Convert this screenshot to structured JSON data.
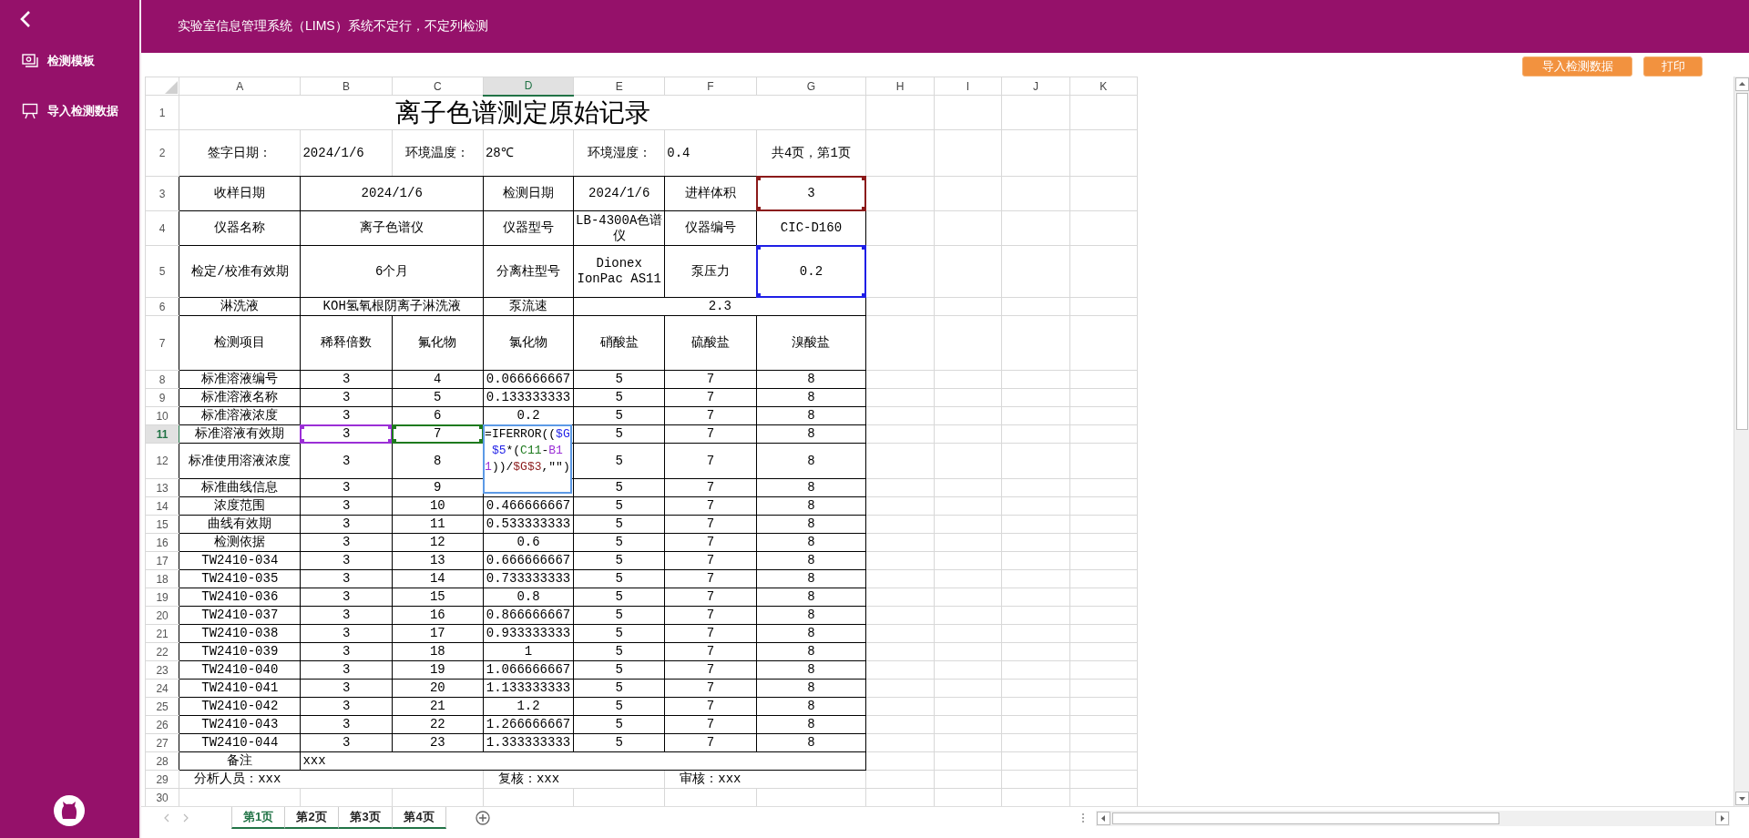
{
  "sidebar": {
    "items": [
      {
        "label": "检测模板"
      },
      {
        "label": "导入检测数据"
      }
    ]
  },
  "header": {
    "title": "实验室信息管理系统（LIMS）系统不定行，不定列检测"
  },
  "toolbar": {
    "buttons": [
      "导入检测数据",
      "打印"
    ]
  },
  "sheet": {
    "columns": [
      {
        "label": "A",
        "selected": false
      },
      {
        "label": "B",
        "selected": false
      },
      {
        "label": "C",
        "selected": false
      },
      {
        "label": "D",
        "selected": true
      },
      {
        "label": "E",
        "selected": false
      },
      {
        "label": "F",
        "selected": false
      },
      {
        "label": "G",
        "selected": false
      },
      {
        "label": "H",
        "selected": false
      },
      {
        "label": "I",
        "selected": false
      },
      {
        "label": "J",
        "selected": false
      },
      {
        "label": "K",
        "selected": false
      }
    ],
    "rows": [
      {
        "label": "1",
        "selected": false,
        "kind": "title",
        "cells": [
          {
            "text": "离子色谱测定原始记录",
            "colspan": 7
          }
        ]
      },
      {
        "label": "2",
        "selected": false,
        "kind": "info",
        "cells": [
          {
            "text": "签字日期："
          },
          {
            "text": "2024/1/6"
          },
          {
            "text": "环境温度："
          },
          {
            "text": "28℃"
          },
          {
            "text": "环境湿度："
          },
          {
            "text": "0.4"
          },
          {
            "text": "共4页，第1页"
          }
        ]
      },
      {
        "label": "3",
        "selected": false,
        "kind": "table",
        "cells": [
          {
            "text": "收样日期"
          },
          {
            "text": "2024/1/6",
            "colspan": 2
          },
          {
            "text": "检测日期"
          },
          {
            "text": "2024/1/6"
          },
          {
            "text": "进样体积"
          },
          {
            "text": "3",
            "color": "#8b1a1a"
          }
        ]
      },
      {
        "label": "4",
        "selected": false,
        "kind": "table",
        "cells": [
          {
            "text": "仪器名称"
          },
          {
            "text": "离子色谱仪",
            "colspan": 2
          },
          {
            "text": "仪器型号"
          },
          {
            "text": "LB-4300A色谱仪"
          },
          {
            "text": "仪器编号"
          },
          {
            "text": "CIC-D160"
          }
        ]
      },
      {
        "label": "5",
        "selected": false,
        "kind": "table",
        "cells": [
          {
            "text": "检定/校准有效期"
          },
          {
            "text": "6个月",
            "colspan": 2
          },
          {
            "text": "分离柱型号"
          },
          {
            "text": "Dionex IonPac AS11"
          },
          {
            "text": "泵压力"
          },
          {
            "text": "0.2",
            "color": "#1f1fe6"
          }
        ]
      },
      {
        "label": "6",
        "selected": false,
        "kind": "table",
        "cells": [
          {
            "text": "淋洗液"
          },
          {
            "text": "KOH氢氧根阴离子淋洗液",
            "colspan": 2
          },
          {
            "text": "泵流速"
          },
          {
            "text": "2.3",
            "colspan": 3
          }
        ]
      },
      {
        "label": "7",
        "selected": false,
        "kind": "table",
        "cells": [
          {
            "text": "检测项目"
          },
          {
            "text": "稀释倍数"
          },
          {
            "text": "氟化物"
          },
          {
            "text": "氯化物"
          },
          {
            "text": "硝酸盐"
          },
          {
            "text": "硫酸盐"
          },
          {
            "text": "溴酸盐"
          }
        ]
      },
      {
        "label": "8",
        "selected": false,
        "kind": "table",
        "cells": [
          {
            "text": "标准溶液编号"
          },
          {
            "text": "3"
          },
          {
            "text": "4"
          },
          {
            "text": "0.066666667"
          },
          {
            "text": "5"
          },
          {
            "text": "7"
          },
          {
            "text": "8"
          }
        ]
      },
      {
        "label": "9",
        "selected": false,
        "kind": "table",
        "cells": [
          {
            "text": "标准溶液名称"
          },
          {
            "text": "3"
          },
          {
            "text": "5"
          },
          {
            "text": "0.133333333"
          },
          {
            "text": "5"
          },
          {
            "text": "7"
          },
          {
            "text": "8"
          }
        ]
      },
      {
        "label": "10",
        "selected": false,
        "kind": "table",
        "cells": [
          {
            "text": "标准溶液浓度"
          },
          {
            "text": "3"
          },
          {
            "text": "6"
          },
          {
            "text": "0.2"
          },
          {
            "text": "5"
          },
          {
            "text": "7"
          },
          {
            "text": "8"
          }
        ]
      },
      {
        "label": "11",
        "selected": true,
        "kind": "table",
        "cells": [
          {
            "text": "标准溶液有效期"
          },
          {
            "text": "3",
            "color": "#9b2fd6"
          },
          {
            "text": "7",
            "color": "#1e7a1e"
          },
          {
            "formula": [
              {
                "text": "=IFERROR(("
              },
              {
                "text": "$G$5",
                "color": "#1f1fe6"
              },
              {
                "text": "*("
              },
              {
                "text": "C11",
                "color": "#1e7a1e"
              },
              {
                "text": "-"
              },
              {
                "text": "B11",
                "color": "#9b2fd6"
              },
              {
                "text": "))/"
              },
              {
                "text": "$G$3",
                "color": "#8b1a1a"
              },
              {
                "text": ",\"\")"
              }
            ]
          },
          {
            "text": "5"
          },
          {
            "text": "7"
          },
          {
            "text": "8"
          }
        ]
      },
      {
        "label": "12",
        "selected": false,
        "kind": "table",
        "cells": [
          {
            "text": "标准使用溶液浓度"
          },
          {
            "text": "3"
          },
          {
            "text": "8"
          },
          {},
          {
            "text": "5"
          },
          {
            "text": "7"
          },
          {
            "text": "8"
          }
        ]
      },
      {
        "label": "13",
        "selected": false,
        "kind": "table",
        "cells": [
          {
            "text": "标准曲线信息"
          },
          {
            "text": "3"
          },
          {
            "text": "9"
          },
          {},
          {
            "text": "5"
          },
          {
            "text": "7"
          },
          {
            "text": "8"
          }
        ]
      },
      {
        "label": "14",
        "selected": false,
        "kind": "table",
        "cells": [
          {
            "text": "浓度范围"
          },
          {
            "text": "3"
          },
          {
            "text": "10"
          },
          {
            "text": "0.466666667"
          },
          {
            "text": "5"
          },
          {
            "text": "7"
          },
          {
            "text": "8"
          }
        ]
      },
      {
        "label": "15",
        "selected": false,
        "kind": "table",
        "cells": [
          {
            "text": "曲线有效期"
          },
          {
            "text": "3"
          },
          {
            "text": "11"
          },
          {
            "text": "0.533333333"
          },
          {
            "text": "5"
          },
          {
            "text": "7"
          },
          {
            "text": "8"
          }
        ]
      },
      {
        "label": "16",
        "selected": false,
        "kind": "table",
        "cells": [
          {
            "text": "检测依据"
          },
          {
            "text": "3"
          },
          {
            "text": "12"
          },
          {
            "text": "0.6"
          },
          {
            "text": "5"
          },
          {
            "text": "7"
          },
          {
            "text": "8"
          }
        ]
      },
      {
        "label": "17",
        "selected": false,
        "kind": "table",
        "cells": [
          {
            "text": "TW2410-034"
          },
          {
            "text": "3"
          },
          {
            "text": "13"
          },
          {
            "text": "0.666666667"
          },
          {
            "text": "5"
          },
          {
            "text": "7"
          },
          {
            "text": "8"
          }
        ]
      },
      {
        "label": "18",
        "selected": false,
        "kind": "table",
        "cells": [
          {
            "text": "TW2410-035"
          },
          {
            "text": "3"
          },
          {
            "text": "14"
          },
          {
            "text": "0.733333333"
          },
          {
            "text": "5"
          },
          {
            "text": "7"
          },
          {
            "text": "8"
          }
        ]
      },
      {
        "label": "19",
        "selected": false,
        "kind": "table",
        "cells": [
          {
            "text": "TW2410-036"
          },
          {
            "text": "3"
          },
          {
            "text": "15"
          },
          {
            "text": "0.8"
          },
          {
            "text": "5"
          },
          {
            "text": "7"
          },
          {
            "text": "8"
          }
        ]
      },
      {
        "label": "20",
        "selected": false,
        "kind": "table",
        "cells": [
          {
            "text": "TW2410-037"
          },
          {
            "text": "3"
          },
          {
            "text": "16"
          },
          {
            "text": "0.866666667"
          },
          {
            "text": "5"
          },
          {
            "text": "7"
          },
          {
            "text": "8"
          }
        ]
      },
      {
        "label": "21",
        "selected": false,
        "kind": "table",
        "cells": [
          {
            "text": "TW2410-038"
          },
          {
            "text": "3"
          },
          {
            "text": "17"
          },
          {
            "text": "0.933333333"
          },
          {
            "text": "5"
          },
          {
            "text": "7"
          },
          {
            "text": "8"
          }
        ]
      },
      {
        "label": "22",
        "selected": false,
        "kind": "table",
        "cells": [
          {
            "text": "TW2410-039"
          },
          {
            "text": "3"
          },
          {
            "text": "18"
          },
          {
            "text": "1"
          },
          {
            "text": "5"
          },
          {
            "text": "7"
          },
          {
            "text": "8"
          }
        ]
      },
      {
        "label": "23",
        "selected": false,
        "kind": "table",
        "cells": [
          {
            "text": "TW2410-040"
          },
          {
            "text": "3"
          },
          {
            "text": "19"
          },
          {
            "text": "1.066666667"
          },
          {
            "text": "5"
          },
          {
            "text": "7"
          },
          {
            "text": "8"
          }
        ]
      },
      {
        "label": "24",
        "selected": false,
        "kind": "table",
        "cells": [
          {
            "text": "TW2410-041"
          },
          {
            "text": "3"
          },
          {
            "text": "20"
          },
          {
            "text": "1.133333333"
          },
          {
            "text": "5"
          },
          {
            "text": "7"
          },
          {
            "text": "8"
          }
        ]
      },
      {
        "label": "25",
        "selected": false,
        "kind": "table",
        "cells": [
          {
            "text": "TW2410-042"
          },
          {
            "text": "3"
          },
          {
            "text": "21"
          },
          {
            "text": "1.2"
          },
          {
            "text": "5"
          },
          {
            "text": "7"
          },
          {
            "text": "8"
          }
        ]
      },
      {
        "label": "26",
        "selected": false,
        "kind": "table",
        "cells": [
          {
            "text": "TW2410-043"
          },
          {
            "text": "3"
          },
          {
            "text": "22"
          },
          {
            "text": "1.266666667"
          },
          {
            "text": "5"
          },
          {
            "text": "7"
          },
          {
            "text": "8"
          }
        ]
      },
      {
        "label": "27",
        "selected": false,
        "kind": "table",
        "cells": [
          {
            "text": "TW2410-044"
          },
          {
            "text": "3"
          },
          {
            "text": "23"
          },
          {
            "text": "1.333333333"
          },
          {
            "text": "5"
          },
          {
            "text": "7"
          },
          {
            "text": "8"
          }
        ]
      },
      {
        "label": "28",
        "selected": false,
        "kind": "remark",
        "cells": [
          {
            "text": "备注"
          },
          {
            "text": "xxx",
            "colspan": 6
          }
        ]
      },
      {
        "label": "29",
        "selected": false,
        "kind": "footer",
        "cells": [
          {
            "text": "分析人员：xxx",
            "colspan": 3
          },
          {
            "text": "复核：xxx",
            "colspan": 2
          },
          {
            "text": "审核：xxx",
            "colspan": 2
          }
        ]
      },
      {
        "label": "30",
        "selected": false,
        "kind": "empty",
        "cells": []
      }
    ]
  },
  "tabs": [
    {
      "label": "第1页",
      "selected": true
    },
    {
      "label": "第2页",
      "selected": false
    },
    {
      "label": "第3页",
      "selected": false
    },
    {
      "label": "第4页",
      "selected": false
    }
  ]
}
